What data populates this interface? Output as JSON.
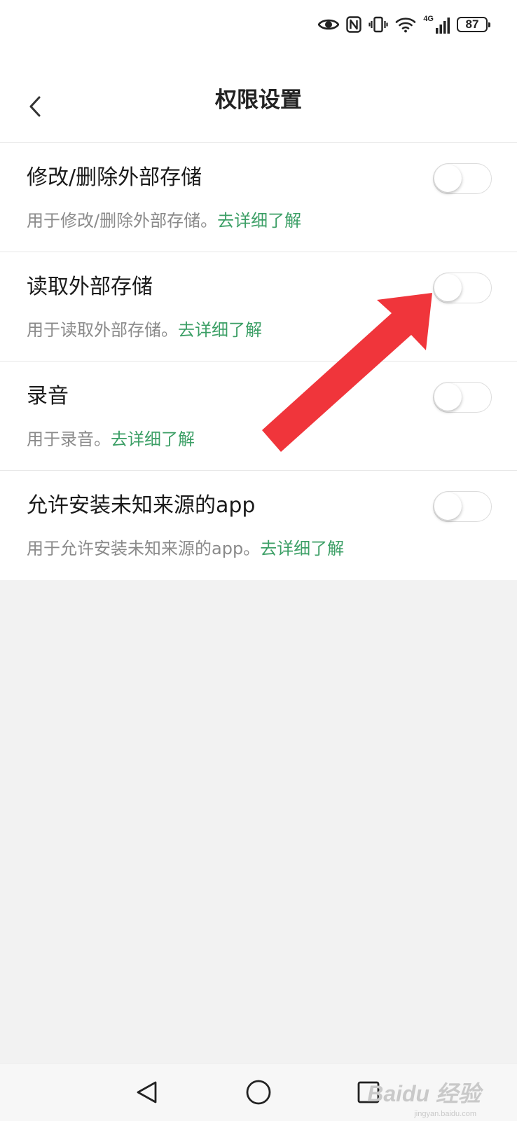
{
  "status_bar": {
    "battery_level": "87",
    "network_label": "4G",
    "icons": [
      "eye-icon",
      "nfc-icon",
      "vibrate-icon",
      "wifi-icon",
      "cellular-signal-icon",
      "battery-icon"
    ]
  },
  "header": {
    "title": "权限设置",
    "back_icon": "chevron-left-icon"
  },
  "permissions": [
    {
      "title": "修改/删除外部存储",
      "description": "用于修改/删除外部存储。",
      "link_label": "去详细了解",
      "enabled": false
    },
    {
      "title": "读取外部存储",
      "description": "用于读取外部存储。",
      "link_label": "去详细了解",
      "enabled": false
    },
    {
      "title": "录音",
      "description": "用于录音。",
      "link_label": "去详细了解",
      "enabled": false
    },
    {
      "title": "允许安装未知来源的app",
      "description": "用于允许安装未知来源的app。",
      "link_label": "去详细了解",
      "enabled": false
    }
  ],
  "nav_bar": {
    "icons": [
      "back-triangle-icon",
      "home-circle-icon",
      "recents-square-icon"
    ]
  },
  "watermark": {
    "main": "Baidu 经验",
    "sub": "jingyan.baidu.com"
  },
  "colors": {
    "link": "#3c9f66",
    "annotation_arrow": "#f0353b",
    "page_background": "#f2f2f2"
  }
}
